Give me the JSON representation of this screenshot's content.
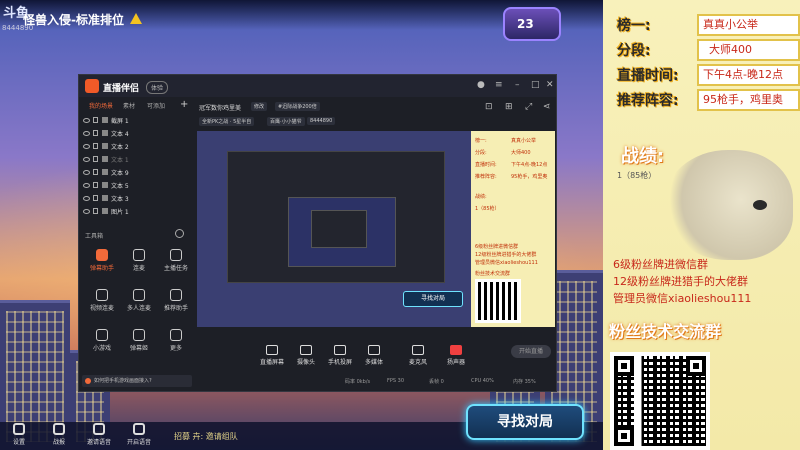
{
  "game": {
    "brand": "斗鱼",
    "title": "怪兽入侵-标准排位",
    "room_id": "8444890",
    "timer": "23",
    "invite_label": "招募",
    "invite_text": "邀请组队",
    "find_match": "寻找对局",
    "bottom_items": [
      "设置",
      "战报",
      "邀请语音",
      "开启语音"
    ]
  },
  "app": {
    "name": "直播伴侣",
    "badge": "体验",
    "tabs": [
      "我的场景",
      "素材",
      "可添加"
    ],
    "sources": [
      {
        "label": "截屏 1",
        "dim": false
      },
      {
        "label": "文本 4",
        "dim": false
      },
      {
        "label": "文本 2",
        "dim": false
      },
      {
        "label": "文本 1",
        "dim": true
      },
      {
        "label": "文本 9",
        "dim": false
      },
      {
        "label": "文本 5",
        "dim": false
      },
      {
        "label": "文本 3",
        "dim": false
      },
      {
        "label": "图片 1",
        "dim": false
      }
    ],
    "toolbox_title": "工具箱",
    "tools": [
      "弹幕助手",
      "连麦",
      "主播任务",
      "视频连麦",
      "多人连麦",
      "推荐助手",
      "小游戏",
      "弹幕姬",
      "更多"
    ],
    "tip": "如何把手机游戏画面接入?",
    "scene_name": "冠军数你鸡里美",
    "scene_edit": "修改",
    "scene_tag": "#迅际战争200倍",
    "scene_pills": [
      "全新PK之战 · 5星半自",
      "百鹰·小小猫爷",
      "8444890"
    ],
    "mini_find": "寻找对局",
    "controls": [
      "直播屏幕",
      "摄像头",
      "手机投屏",
      "多媒体",
      "麦克风",
      "扬声器"
    ],
    "start_live": "开始直播",
    "status": [
      "码率 0kb/s",
      "FPS 30",
      "丢帧 0",
      "CPU 40%",
      "内存 35%"
    ]
  },
  "panel": {
    "rank_label": "榜一:",
    "rank_value": "真真小公举",
    "tier_label": "分段:",
    "tier_value": "大师400",
    "time_label": "直播时间:",
    "time_value": "下午4点-晚12点",
    "lineup_label": "推荐阵容:",
    "lineup_value": "95枪手，鸡里奥",
    "record_title": "战绩:",
    "record_value": "1（85枪）",
    "groups": [
      "6级粉丝牌进微信群",
      "12级粉丝牌进猎手的大佬群",
      "管理员微信xiaolieshou111"
    ],
    "tech_group": "粉丝技术交流群"
  },
  "colors": {
    "accent": "#f26a3a",
    "panel_bg": "#f8f1bb",
    "panel_text": "#c8281a",
    "match_border": "#6fe3ff"
  }
}
